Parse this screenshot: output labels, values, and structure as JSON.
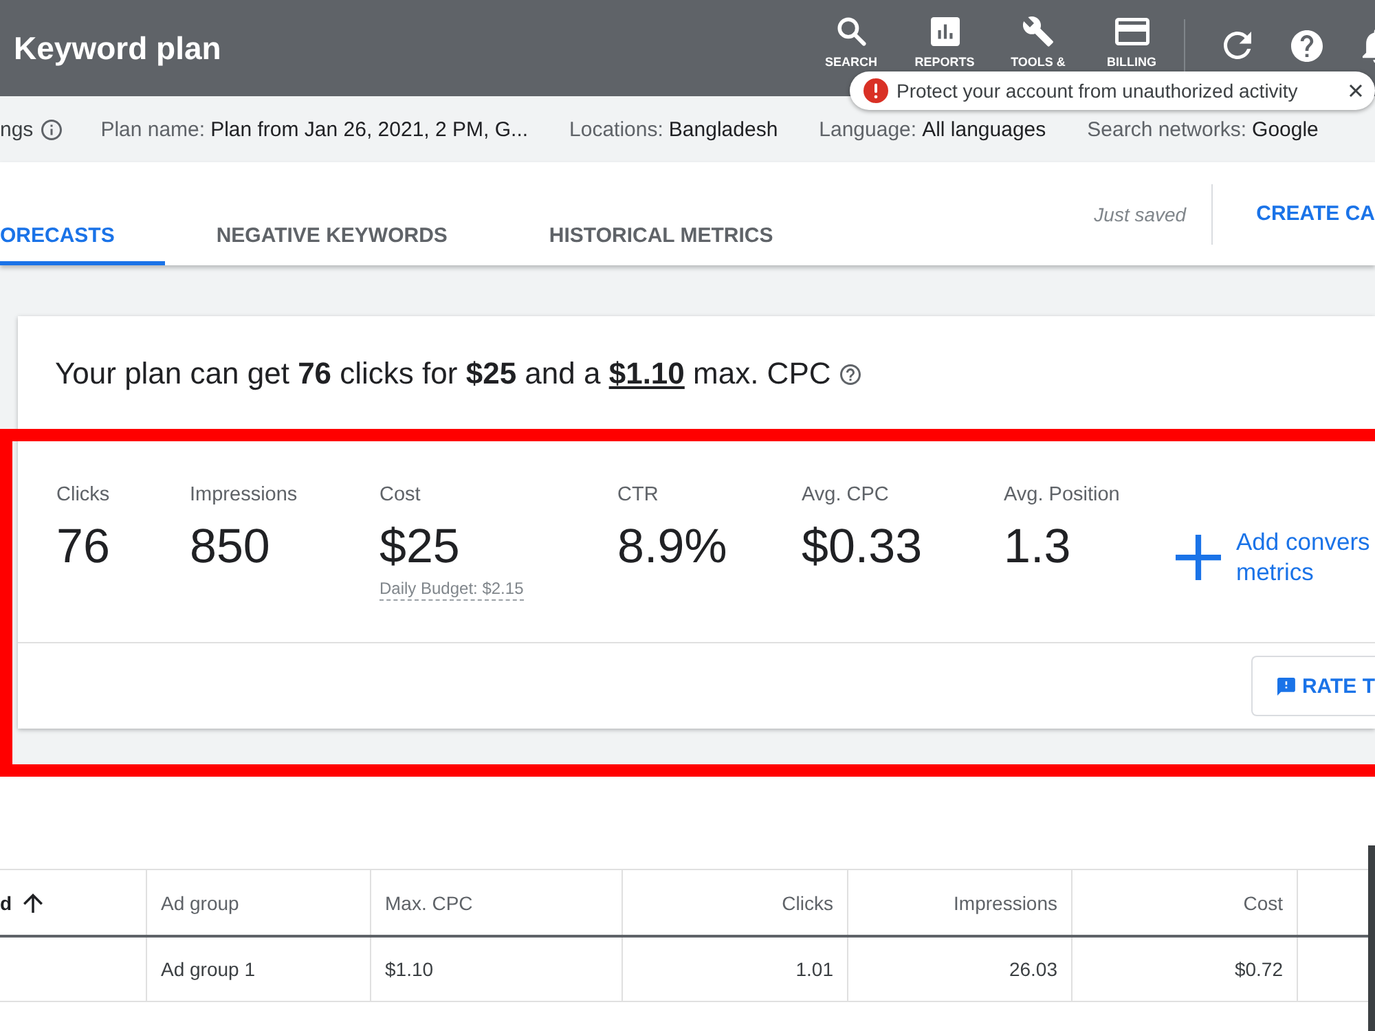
{
  "header": {
    "title": "Keyword plan",
    "nav": [
      {
        "kind": "search",
        "label": "SEARCH"
      },
      {
        "kind": "reports",
        "label": "REPORTS"
      },
      {
        "kind": "tools",
        "label": "TOOLS &"
      },
      {
        "kind": "billing",
        "label": "BILLING"
      }
    ]
  },
  "notification": {
    "text": "Protect your account from unauthorized activity"
  },
  "plan_bar": {
    "settings_link": "ngs",
    "details": [
      {
        "label": "Plan name:",
        "value": "Plan from Jan 26, 2021, 2 PM, G..."
      },
      {
        "label": "Locations:",
        "value": "Bangladesh"
      },
      {
        "label": "Language:",
        "value": "All languages"
      },
      {
        "label": "Search networks:",
        "value": "Google"
      }
    ]
  },
  "tabs": [
    {
      "label": "ORECASTS",
      "selected": true
    },
    {
      "label": "NEGATIVE KEYWORDS",
      "selected": false
    },
    {
      "label": "HISTORICAL METRICS",
      "selected": false
    }
  ],
  "toolbar": {
    "save_status": "Just saved",
    "create_button": "CREATE CA"
  },
  "forecast": {
    "summary": "Your plan can get **76** clicks for **$25** and a **$1.10** max. CPC",
    "metrics": [
      {
        "label": "Clicks",
        "value": "76"
      },
      {
        "label": "Impressions",
        "value": "850"
      },
      {
        "label": "Cost",
        "value": "$25",
        "note": "Daily Budget: $2.15"
      },
      {
        "label": "CTR",
        "value": "8.9%"
      },
      {
        "label": "Avg. CPC",
        "value": "$0.33"
      },
      {
        "label": "Avg. Position",
        "value": "1.3"
      }
    ],
    "add_metrics_link": [
      "Add convers",
      "metrics"
    ],
    "rate_button": "RATE T"
  },
  "table": {
    "columns": [
      {
        "label": "d",
        "kind": "text",
        "sorted": true
      },
      {
        "label": "Ad group",
        "kind": "text",
        "sorted": false
      },
      {
        "label": "Max. CPC",
        "kind": "text",
        "sorted": false
      },
      {
        "label": "Clicks",
        "kind": "number",
        "sorted": false
      },
      {
        "label": "Impressions",
        "kind": "number",
        "sorted": false
      },
      {
        "label": "Cost",
        "kind": "number",
        "sorted": false
      }
    ],
    "rows": [
      {
        "cells": [
          null,
          "Ad group 1",
          "$1.10",
          "1.01",
          "26.03",
          "$0.72"
        ]
      }
    ]
  }
}
